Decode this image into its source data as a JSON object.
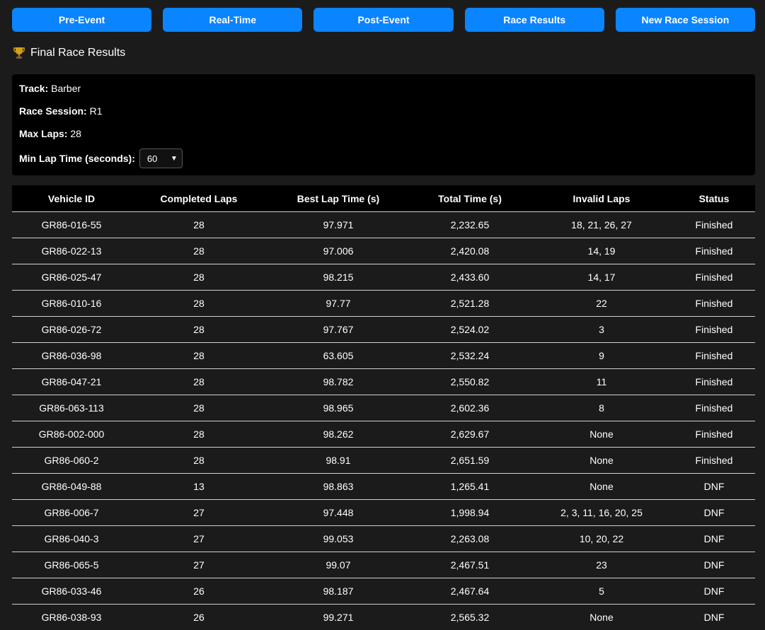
{
  "nav": {
    "buttons": [
      "Pre-Event",
      "Real-Time",
      "Post-Event",
      "Race Results",
      "New Race Session"
    ]
  },
  "section": {
    "title": "Final Race Results",
    "icon": "trophy-icon"
  },
  "info": {
    "track_label": "Track:",
    "track_value": "Barber",
    "session_label": "Race Session:",
    "session_value": "R1",
    "max_laps_label": "Max Laps:",
    "max_laps_value": "28",
    "min_lap_label": "Min Lap Time (seconds):",
    "min_lap_value": "60"
  },
  "colors": {
    "accent": "#0a84ff",
    "background": "#1b1b1b",
    "panel": "#000000"
  },
  "table": {
    "headers": [
      "Vehicle ID",
      "Completed Laps",
      "Best Lap Time (s)",
      "Total Time (s)",
      "Invalid Laps",
      "Status"
    ],
    "rows": [
      [
        "GR86-016-55",
        "28",
        "97.971",
        "2,232.65",
        "18, 21, 26, 27",
        "Finished"
      ],
      [
        "GR86-022-13",
        "28",
        "97.006",
        "2,420.08",
        "14, 19",
        "Finished"
      ],
      [
        "GR86-025-47",
        "28",
        "98.215",
        "2,433.60",
        "14, 17",
        "Finished"
      ],
      [
        "GR86-010-16",
        "28",
        "97.77",
        "2,521.28",
        "22",
        "Finished"
      ],
      [
        "GR86-026-72",
        "28",
        "97.767",
        "2,524.02",
        "3",
        "Finished"
      ],
      [
        "GR86-036-98",
        "28",
        "63.605",
        "2,532.24",
        "9",
        "Finished"
      ],
      [
        "GR86-047-21",
        "28",
        "98.782",
        "2,550.82",
        "11",
        "Finished"
      ],
      [
        "GR86-063-113",
        "28",
        "98.965",
        "2,602.36",
        "8",
        "Finished"
      ],
      [
        "GR86-002-000",
        "28",
        "98.262",
        "2,629.67",
        "None",
        "Finished"
      ],
      [
        "GR86-060-2",
        "28",
        "98.91",
        "2,651.59",
        "None",
        "Finished"
      ],
      [
        "GR86-049-88",
        "13",
        "98.863",
        "1,265.41",
        "None",
        "DNF"
      ],
      [
        "GR86-006-7",
        "27",
        "97.448",
        "1,998.94",
        "2, 3, 11, 16, 20, 25",
        "DNF"
      ],
      [
        "GR86-040-3",
        "27",
        "99.053",
        "2,263.08",
        "10, 20, 22",
        "DNF"
      ],
      [
        "GR86-065-5",
        "27",
        "99.07",
        "2,467.51",
        "23",
        "DNF"
      ],
      [
        "GR86-033-46",
        "26",
        "98.187",
        "2,467.64",
        "5",
        "DNF"
      ],
      [
        "GR86-038-93",
        "26",
        "99.271",
        "2,565.32",
        "None",
        "DNF"
      ]
    ]
  }
}
